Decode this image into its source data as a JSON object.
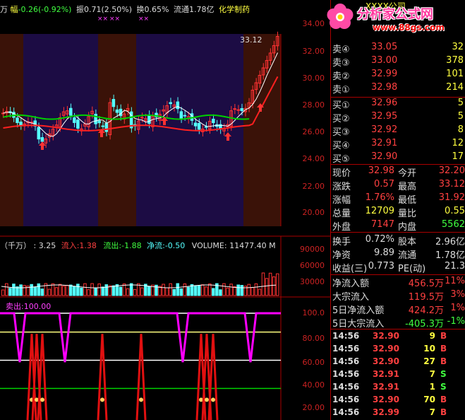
{
  "header": {
    "prefix": "万",
    "change_label": "幅",
    "change_value": "-0.26(-0.92%)",
    "amplitude_label": "振",
    "amplitude_value": "0.71(2.50%)",
    "turnover_label": "换",
    "turnover_value": "0.65%",
    "float_label": "流通",
    "float_value": "1.78亿",
    "industry": "化学制药",
    "marks": [
      "××",
      "××",
      "××"
    ]
  },
  "logo": {
    "brand": "分析家公式网",
    "url": "www.88gs.com"
  },
  "price_axis": [
    "34.00",
    "32.00",
    "30.00",
    "28.00",
    "26.00",
    "24.00",
    "22.00",
    "20.00"
  ],
  "price_annotation": "33.12",
  "volume_legend": {
    "unit": "（千万）",
    "value": ": 3.25",
    "inflow_label": "流入:",
    "inflow_value": "1.38",
    "outflow_label": "流出:",
    "outflow_value": "-1.88",
    "net_label": "净流:",
    "net_value": "-0.50",
    "volume_label": "VOLUME:",
    "volume_value": "11477.40",
    "suffix": "M"
  },
  "volume_axis": [
    "90000",
    "60000",
    "30000"
  ],
  "indicator_legend": {
    "label": "卖出:",
    "value": "100.00"
  },
  "indicator_axis": [
    "100.0",
    "80.00",
    "60.00",
    "40.00",
    "20.00"
  ],
  "colors": {
    "up": "#ff3232",
    "down": "#54fcfc",
    "ma_green": "#00d000",
    "ma_red": "#ff2020",
    "magenta": "#ff00ff",
    "yellow": "#ffff80",
    "bg_brown": "#3a1208",
    "bg_purple": "#1c0c44"
  },
  "stock_name": "XXXX公司",
  "order_book": {
    "asks": [
      {
        "label": "卖④",
        "price": "33.05",
        "vol": "32"
      },
      {
        "label": "卖③",
        "price": "33.00",
        "vol": "378"
      },
      {
        "label": "卖②",
        "price": "32.99",
        "vol": "101"
      },
      {
        "label": "卖①",
        "price": "32.98",
        "vol": "214"
      }
    ],
    "bids": [
      {
        "label": "买①",
        "price": "32.96",
        "vol": "5"
      },
      {
        "label": "买②",
        "price": "32.95",
        "vol": "5"
      },
      {
        "label": "买③",
        "price": "32.92",
        "vol": "8"
      },
      {
        "label": "买④",
        "price": "32.91",
        "vol": "12"
      },
      {
        "label": "买⑤",
        "price": "32.90",
        "vol": "17"
      }
    ]
  },
  "stats": [
    {
      "l1": "现价",
      "v1": "32.98",
      "l2": "今开",
      "v2": "32.20",
      "c1": "#ff4040",
      "c2": "#ff4040"
    },
    {
      "l1": "涨跌",
      "v1": "0.57",
      "l2": "最高",
      "v2": "33.12",
      "c1": "#ff4040",
      "c2": "#ff4040"
    },
    {
      "l1": "涨幅",
      "v1": "1.76%",
      "l2": "最低",
      "v2": "31.92",
      "c1": "#ff4040",
      "c2": "#ff4040"
    },
    {
      "l1": "总量",
      "v1": "12709",
      "l2": "量比",
      "v2": "0.55",
      "c1": "#ffff40",
      "c2": "#ffff40"
    },
    {
      "l1": "外盘",
      "v1": "7147",
      "l2": "内盘",
      "v2": "5562",
      "c1": "#ff4040",
      "c2": "#40ff40"
    }
  ],
  "stats2": [
    {
      "l1": "换手",
      "v1": "0.72%",
      "l2": "股本",
      "v2": "2.96亿"
    },
    {
      "l1": "净资",
      "v1": "9.89",
      "l2": "流通",
      "v2": "1.78亿"
    },
    {
      "l1": "收益(三)",
      "v1": "0.773",
      "l2": "PE(动)",
      "v2": "21.3"
    }
  ],
  "fund_flow": [
    {
      "label": "净流入额",
      "value": "456.5万",
      "pct": "11%",
      "color": "#ff4040"
    },
    {
      "label": "大宗流入",
      "value": "119.5万",
      "pct": "3%",
      "color": "#ff4040"
    },
    {
      "label": "5日净流入额",
      "value": "424.2万",
      "pct": "1%",
      "color": "#ff4040"
    },
    {
      "label": "5日大宗流入",
      "value": "-405.3万",
      "pct": "-1%",
      "color": "#40ff40"
    }
  ],
  "ticks": [
    {
      "time": "14:56",
      "price": "32.90",
      "vol": "9",
      "side": "B"
    },
    {
      "time": "14:56",
      "price": "32.90",
      "vol": "10",
      "side": "B"
    },
    {
      "time": "14:56",
      "price": "32.90",
      "vol": "27",
      "side": "B"
    },
    {
      "time": "14:56",
      "price": "32.91",
      "vol": "7",
      "side": "S"
    },
    {
      "time": "14:56",
      "price": "32.91",
      "vol": "1",
      "side": "S"
    },
    {
      "time": "14:56",
      "price": "32.90",
      "vol": "70",
      "side": "B"
    },
    {
      "time": "14:56",
      "price": "32.99",
      "vol": "7",
      "side": "B"
    }
  ]
}
